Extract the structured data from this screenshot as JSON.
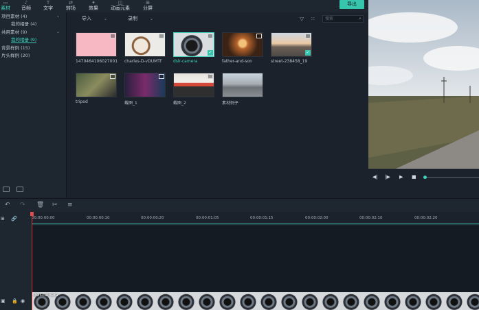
{
  "top_tabs": [
    {
      "label": "素材",
      "icon": "folder-icon",
      "active": true
    },
    {
      "label": "音频",
      "icon": "music-icon",
      "active": false
    },
    {
      "label": "文字",
      "icon": "text-icon",
      "active": false
    },
    {
      "label": "转场",
      "icon": "transition-icon",
      "active": false
    },
    {
      "label": "效果",
      "icon": "effects-icon",
      "active": false
    },
    {
      "label": "动画元素",
      "icon": "elements-icon",
      "active": false
    },
    {
      "label": "分屏",
      "icon": "split-screen-icon",
      "active": false
    }
  ],
  "export_label": "导出",
  "tree": {
    "items": [
      {
        "label": "项目素材 (4)",
        "level": 0,
        "arrow": true
      },
      {
        "label": "我的相册 (4)",
        "level": 1
      },
      {
        "label": "共用素材 (9)",
        "level": 0,
        "arrow": true
      },
      {
        "label": "我的相册 (9)",
        "level": 1,
        "selected": true
      },
      {
        "label": "背景样例 (15)",
        "level": 0
      },
      {
        "label": "片头样例 (20)",
        "level": 0
      }
    ]
  },
  "toolbar": {
    "import_label": "导入",
    "record_label": "录制",
    "search_placeholder": "搜索"
  },
  "media": [
    {
      "caption": "1470464106027001",
      "checked": false,
      "selected": false
    },
    {
      "caption": "charles-D-vDUMTf",
      "checked": false,
      "selected": false
    },
    {
      "caption": "dslr-camera",
      "checked": true,
      "selected": true
    },
    {
      "caption": "father-and-son",
      "checked": false,
      "selected": false
    },
    {
      "caption": "street-238458_19",
      "checked": true,
      "selected": false
    },
    {
      "caption": "tripod",
      "checked": false,
      "selected": false
    },
    {
      "caption": "截图_1",
      "checked": false,
      "selected": false
    },
    {
      "caption": "截图_2",
      "checked": false,
      "selected": false
    },
    {
      "caption": "素材例子",
      "checked": false,
      "selected": false
    }
  ],
  "timeline": {
    "ticks": [
      "00:00:00:00",
      "00:00:00:10",
      "00:00:00:20",
      "00:00:01:05",
      "00:00:01:15",
      "00:00:02:00",
      "00:00:02:10",
      "00:00:02:20"
    ],
    "clip_name": "dslr-camera"
  },
  "colors": {
    "accent": "#37c6ad",
    "playhead": "#e04d4d"
  }
}
